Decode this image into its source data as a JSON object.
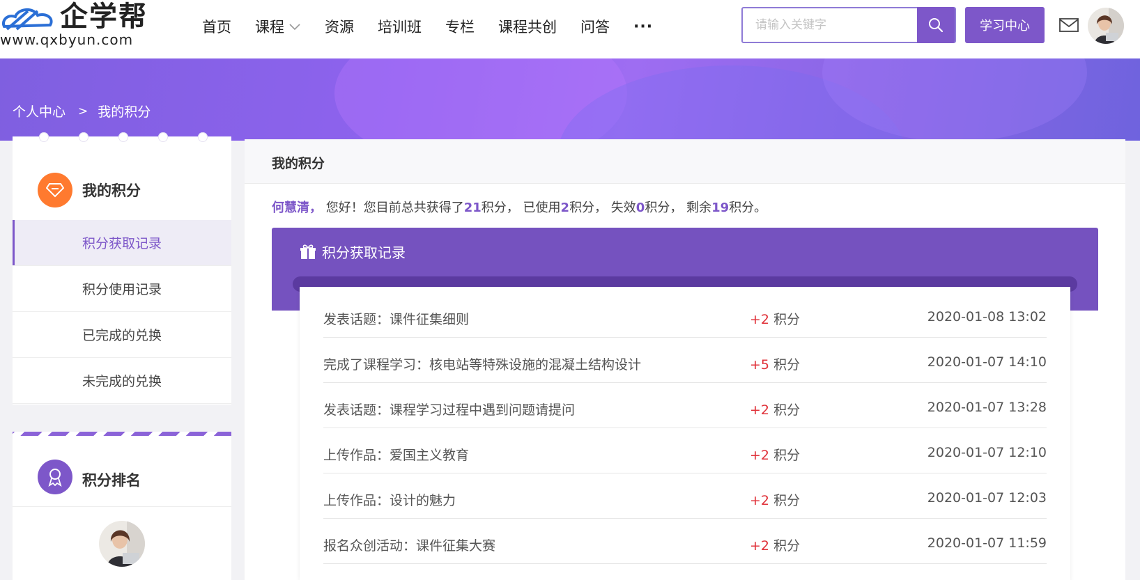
{
  "header": {
    "logo_text": "企学帮",
    "logo_url": "www.qxbyun.com",
    "nav": [
      "首页",
      "课程",
      "资源",
      "培训班",
      "专栏",
      "课程共创",
      "问答"
    ],
    "nav_more": "···",
    "search_placeholder": "请输入关键字",
    "study_center": "学习中心",
    "accent_color": "#7d57c9"
  },
  "breadcrumb": {
    "home": "个人中心",
    "sep": ">",
    "current": "我的积分"
  },
  "sidebar": {
    "points_title": "我的积分",
    "menu": [
      "积分获取记录",
      "积分使用记录",
      "已完成的兑换",
      "未完成的兑换"
    ],
    "active_index": 0,
    "ranking_title": "积分排名"
  },
  "main": {
    "title": "我的积分",
    "summary": {
      "name": "何慧清，",
      "t1": "您好！您目前总共获得了",
      "earned": "21",
      "t2": "积分， 已使用",
      "used": "2",
      "t3": "积分， 失效",
      "expired": "0",
      "t4": "积分， 剩余",
      "remaining": "19",
      "t5": "积分。"
    },
    "records_title": "积分获取记录",
    "records": [
      {
        "desc": "发表话题：课件征集细则",
        "plus": "+2",
        "unit": "积分",
        "time": "2020-01-08 13:02"
      },
      {
        "desc": "完成了课程学习：核电站等特殊设施的混凝土结构设计",
        "plus": "+5",
        "unit": "积分",
        "time": "2020-01-07 14:10"
      },
      {
        "desc": "发表话题：课程学习过程中遇到问题请提问",
        "plus": "+2",
        "unit": "积分",
        "time": "2020-01-07 13:28"
      },
      {
        "desc": "上传作品：爱国主义教育",
        "plus": "+2",
        "unit": "积分",
        "time": "2020-01-07 12:10"
      },
      {
        "desc": "上传作品：设计的魅力",
        "plus": "+2",
        "unit": "积分",
        "time": "2020-01-07 12:03"
      },
      {
        "desc": "报名众创活动：课件征集大赛",
        "plus": "+2",
        "unit": "积分",
        "time": "2020-01-07 11:59"
      }
    ]
  }
}
